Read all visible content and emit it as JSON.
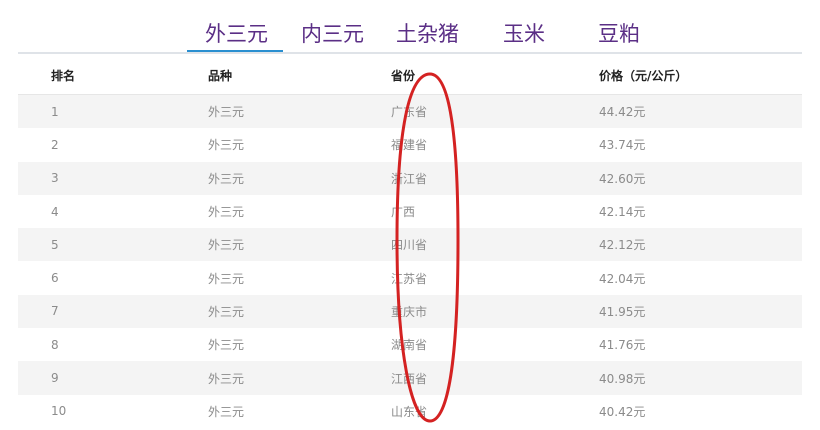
{
  "tabs": [
    {
      "label": "外三元",
      "active": true
    },
    {
      "label": "内三元",
      "active": false
    },
    {
      "label": "土杂猪",
      "active": false
    },
    {
      "label": "玉米",
      "active": false
    },
    {
      "label": "豆粕",
      "active": false
    }
  ],
  "table": {
    "headers": {
      "rank": "排名",
      "variety": "品种",
      "province": "省份",
      "price": "价格（元/公斤）"
    },
    "rows": [
      {
        "rank": "1",
        "variety": "外三元",
        "province": "广东省",
        "price": "44.42元"
      },
      {
        "rank": "2",
        "variety": "外三元",
        "province": "福建省",
        "price": "43.74元"
      },
      {
        "rank": "3",
        "variety": "外三元",
        "province": "浙江省",
        "price": "42.60元"
      },
      {
        "rank": "4",
        "variety": "外三元",
        "province": "广西",
        "price": "42.14元"
      },
      {
        "rank": "5",
        "variety": "外三元",
        "province": "四川省",
        "price": "42.12元"
      },
      {
        "rank": "6",
        "variety": "外三元",
        "province": "江苏省",
        "price": "42.04元"
      },
      {
        "rank": "7",
        "variety": "外三元",
        "province": "重庆市",
        "price": "41.95元"
      },
      {
        "rank": "8",
        "variety": "外三元",
        "province": "湖南省",
        "price": "41.76元"
      },
      {
        "rank": "9",
        "variety": "外三元",
        "province": "江西省",
        "price": "40.98元"
      },
      {
        "rank": "10",
        "variety": "外三元",
        "province": "山东省",
        "price": "40.42元"
      }
    ]
  },
  "colors": {
    "tab_text": "#5b2f86",
    "tab_active_underline": "#2a8fd0",
    "row_alt_background": "#f4f4f4",
    "annotation_circle": "#d42222"
  }
}
